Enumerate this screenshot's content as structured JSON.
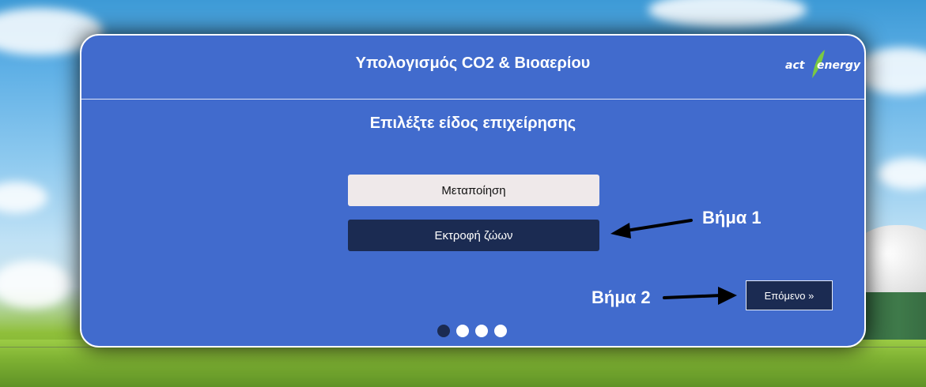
{
  "header": {
    "title": "Υπολογισμός CO2 & Βιοαερίου",
    "logo_part1": "act",
    "logo_part2": "energy"
  },
  "subtitle": "Επιλέξτε είδος επιχείρησης",
  "options": [
    {
      "label": "Μεταποίηση",
      "selected": false
    },
    {
      "label": "Εκτροφή ζώων",
      "selected": true
    }
  ],
  "next_button": "Επόμενο »",
  "annotations": {
    "step1": "Βήμα 1",
    "step2": "Βήμα 2"
  },
  "progress": {
    "current_step": 1,
    "total_steps": 4
  },
  "colors": {
    "card_bg": "#416bcd",
    "dark_button": "#1b2b52",
    "light_button": "#efe9ea",
    "logo_leaf": "#7ac943"
  }
}
